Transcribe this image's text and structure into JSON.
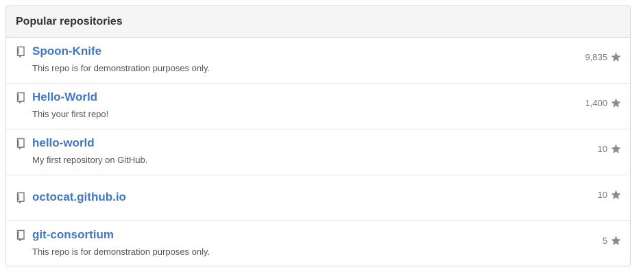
{
  "panel": {
    "title": "Popular repositories"
  },
  "repos": [
    {
      "name": "Spoon-Knife",
      "description": "This repo is for demonstration purposes only.",
      "stars": "9,835"
    },
    {
      "name": "Hello-World",
      "description": "This your first repo!",
      "stars": "1,400"
    },
    {
      "name": "hello-world",
      "description": "My first repository on GitHub.",
      "stars": "10"
    },
    {
      "name": "octocat.github.io",
      "description": "",
      "stars": "10"
    },
    {
      "name": "git-consortium",
      "description": "This repo is for demonstration purposes only.",
      "stars": "5"
    }
  ],
  "icons": {
    "repo": "repo-book-icon",
    "star": "star-icon"
  },
  "colors": {
    "link": "#4078c0",
    "header_bg": "#f5f5f5",
    "border": "#d8d8d8",
    "muted": "#767676"
  }
}
